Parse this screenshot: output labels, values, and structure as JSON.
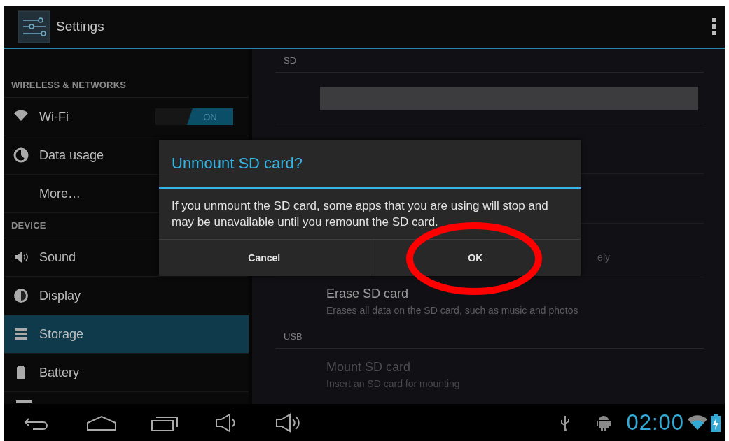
{
  "action_bar": {
    "title": "Settings"
  },
  "sidebar": {
    "items": [
      {
        "kind": "header",
        "label": "WIRELESS & NETWORKS"
      },
      {
        "kind": "item",
        "label": "Wi-Fi",
        "selected": false,
        "toggle": {
          "label": "ON",
          "on": true
        }
      },
      {
        "kind": "item",
        "label": "Data usage",
        "selected": false
      },
      {
        "kind": "item",
        "label": "More…",
        "selected": false
      },
      {
        "kind": "header",
        "label": "DEVICE"
      },
      {
        "kind": "item",
        "label": "Sound",
        "selected": false
      },
      {
        "kind": "item",
        "label": "Display",
        "selected": false
      },
      {
        "kind": "item",
        "label": "Storage",
        "selected": true
      },
      {
        "kind": "item",
        "label": "Battery",
        "selected": false
      }
    ]
  },
  "storage": {
    "sections": [
      {
        "header": "SD",
        "items": [
          {
            "kind": "bar"
          },
          {
            "kind": "covered"
          },
          {
            "kind": "covered"
          },
          {
            "kind": "covered",
            "fragment": "ely"
          },
          {
            "kind": "text",
            "title": "Erase SD card",
            "subtitle": "Erases all data on the SD card, such as music and photos",
            "disabled": false
          }
        ]
      },
      {
        "header": "USB",
        "items": [
          {
            "kind": "text",
            "title": "Mount SD card",
            "subtitle": "Insert an SD card for mounting",
            "disabled": true
          }
        ]
      }
    ]
  },
  "dialog": {
    "title": "Unmount SD card?",
    "message": "If you unmount the SD card, some apps that you are using will stop and may be unavailable until you remount the SD card.",
    "buttons": [
      "Cancel",
      "OK"
    ]
  },
  "nav_bar": {
    "time": "02:00"
  }
}
